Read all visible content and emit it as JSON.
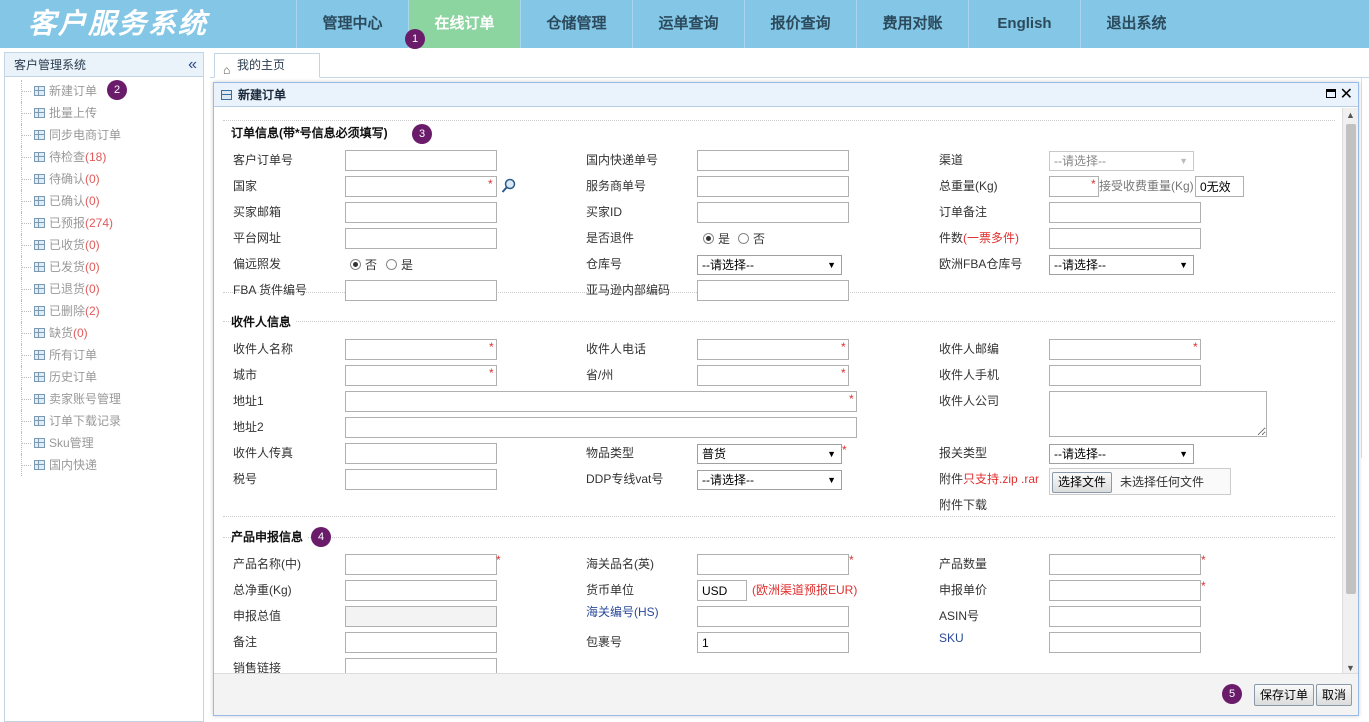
{
  "header": {
    "logo": "客户服务系统",
    "nav": [
      {
        "label": "管理中心"
      },
      {
        "label": "在线订单"
      },
      {
        "label": "仓储管理"
      },
      {
        "label": "运单查询"
      },
      {
        "label": "报价查询"
      },
      {
        "label": "费用对账"
      },
      {
        "label": "English"
      },
      {
        "label": "退出系统"
      }
    ],
    "active_index": 1
  },
  "badges": [
    "1",
    "2",
    "3",
    "4",
    "5"
  ],
  "sidebar": {
    "title": "客户管理系统",
    "collapse_glyph": "«",
    "items": [
      {
        "label": "新建订单",
        "count": ""
      },
      {
        "label": "批量上传",
        "count": ""
      },
      {
        "label": "同步电商订单",
        "count": ""
      },
      {
        "label": "待检查",
        "count": "(18)"
      },
      {
        "label": "待确认",
        "count": "(0)"
      },
      {
        "label": "已确认",
        "count": "(0)"
      },
      {
        "label": "已预报",
        "count": "(274)"
      },
      {
        "label": "已收货",
        "count": "(0)"
      },
      {
        "label": "已发货",
        "count": "(0)"
      },
      {
        "label": "已退货",
        "count": "(0)"
      },
      {
        "label": "已删除",
        "count": "(2)"
      },
      {
        "label": "缺货",
        "count": "(0)"
      },
      {
        "label": "所有订单",
        "count": ""
      },
      {
        "label": "历史订单",
        "count": ""
      },
      {
        "label": "卖家账号管理",
        "count": ""
      },
      {
        "label": "订单下载记录",
        "count": ""
      },
      {
        "label": "Sku管理",
        "count": ""
      },
      {
        "label": "国内快递",
        "count": ""
      }
    ]
  },
  "tabs": {
    "home": "我的主页"
  },
  "dialog": {
    "title": "新建订单",
    "order": {
      "title": "订单信息(带*号信息必须填写)",
      "customer_no": "客户订单号",
      "domestic_no": "国内快递单号",
      "channel": "渠道",
      "channel_ph": "--请选择--",
      "country": "国家",
      "service_no": "服务商单号",
      "gross_weight": "总重量(Kg)",
      "accept_weight": "接受收费重量(Kg)",
      "invalid": "0无效",
      "buyer_email": "买家邮箱",
      "buyer_id": "买家ID",
      "order_note": "订单备注",
      "platform_url": "平台网址",
      "is_return": "是否退件",
      "yes": "是",
      "no": "否",
      "pieces": "件数",
      "pieces_note": "(一票多件)",
      "remote": "偏远照发",
      "warehouse": "仓库号",
      "select_ph": "--请选择--",
      "eu_fba": "欧洲FBA仓库号",
      "fba_no": "FBA 货件编号",
      "amazon_code": "亚马逊内部编码"
    },
    "receiver": {
      "title": "收件人信息",
      "name": "收件人名称",
      "phone": "收件人电话",
      "zip": "收件人邮编",
      "city": "城市",
      "state": "省/州",
      "mobile": "收件人手机",
      "addr1": "地址1",
      "company": "收件人公司",
      "addr2": "地址2",
      "fax": "收件人传真",
      "goods_type": "物品类型",
      "goods_type_val": "普货",
      "customs_type": "报关类型",
      "tax_no": "税号",
      "ddp_vat": "DDP专线vat号",
      "attach": "附件",
      "attach_note": "只支持.zip .rar",
      "choose_file": "选择文件",
      "no_file": "未选择任何文件",
      "attach_download": "附件下载"
    },
    "product": {
      "title": "产品申报信息",
      "name_cn": "产品名称(中)",
      "customs_en": "海关品名(英)",
      "qty": "产品数量",
      "net_weight": "总净重(Kg)",
      "currency": "货币单位",
      "currency_val": "USD",
      "currency_note": "(欧洲渠道预报EUR)",
      "unit_price": "申报单价",
      "total_value": "申报总值",
      "hs_code": "海关编号(HS)",
      "asin": "ASIN号",
      "remark": "备注",
      "package_no": "包裹号",
      "package_val": "1",
      "sku": "SKU",
      "sale_link": "销售链接"
    },
    "save": "保存订单",
    "cancel": "取消"
  }
}
